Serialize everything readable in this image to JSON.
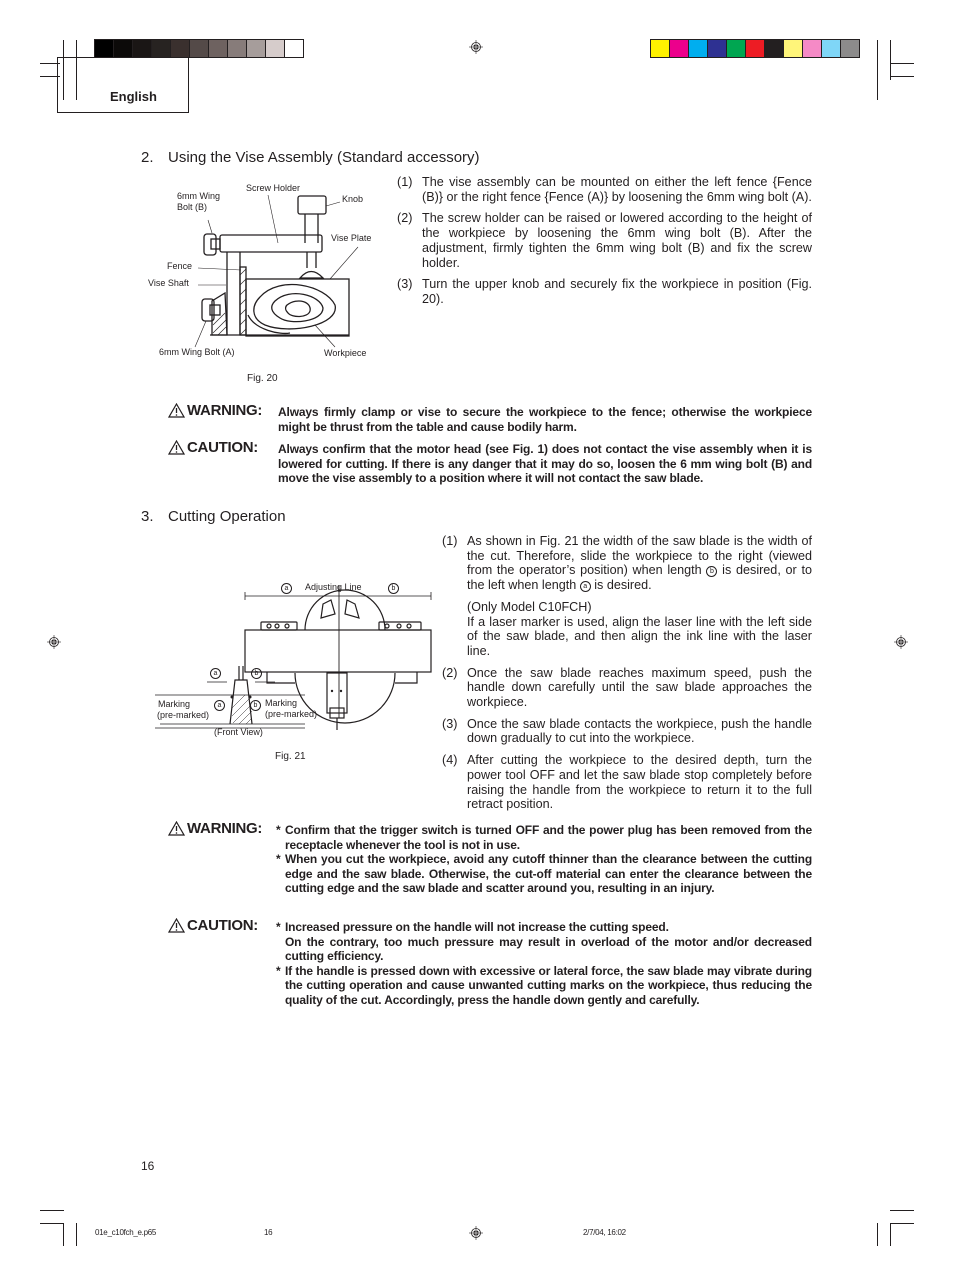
{
  "header": {
    "language": "English",
    "gray_swatches": [
      "#000000",
      "#0c0a09",
      "#1a1615",
      "#272321",
      "#3a302e",
      "#544a48",
      "#6e6260",
      "#877c7a",
      "#a69d9b",
      "#d6cccb",
      "#ffffff"
    ],
    "color_swatches": [
      "#fff200",
      "#ec008c",
      "#00aeef",
      "#2e3192",
      "#00a651",
      "#ed1c24",
      "#231f20",
      "#fff57a",
      "#f58ac6",
      "#7fd6f7",
      "#8c8b8b"
    ]
  },
  "section2": {
    "number": "2.",
    "title": "Using the Vise Assembly (Standard accessory)",
    "figure": {
      "caption": "Fig. 20",
      "labels": {
        "screw_holder": "Screw Holder",
        "wing_bolt_b_line1": "6mm Wing",
        "wing_bolt_b_line2": "Bolt (B)",
        "knob": "Knob",
        "vise_plate": "Vise Plate",
        "fence": "Fence",
        "vise_shaft": "Vise Shaft",
        "wing_bolt_a": "6mm Wing Bolt (A)",
        "workpiece": "Workpiece"
      }
    },
    "steps": [
      {
        "num": "(1)",
        "text": "The vise assembly can be mounted on either the left fence {Fence (B)} or the right fence {Fence (A)} by loosening the 6mm wing bolt (A)."
      },
      {
        "num": "(2)",
        "text": "The screw holder can be raised or lowered according to the height of the workpiece by loosening the 6mm wing bolt (B). After the adjustment, firmly tighten the 6mm wing bolt (B) and fix the screw holder."
      },
      {
        "num": "(3)",
        "text": "Turn the upper knob and securely fix the workpiece in position (Fig. 20)."
      }
    ],
    "warning": {
      "label": "WARNING:",
      "text": "Always firmly clamp or vise to secure the workpiece to the fence; otherwise the workpiece might be thrust from the table and  cause bodily harm."
    },
    "caution": {
      "label": "CAUTION:",
      "text": "Always confirm that the motor head (see Fig. 1) does not contact the vise assembly when it is lowered for cutting. If there is any danger that it may do so, loosen the 6 mm wing bolt (B) and move the vise assembly to a position where it will not contact the saw blade."
    }
  },
  "section3": {
    "number": "3.",
    "title": "Cutting Operation",
    "figure": {
      "caption": "Fig. 21",
      "labels": {
        "a": "a",
        "b": "b",
        "adjusting_line": "Adjusting Line",
        "marking_left_1": "Marking",
        "marking_left_2": "(pre-marked)",
        "marking_right_1": "Marking",
        "marking_right_2": "(pre-marked)",
        "front_view": "(Front View)"
      }
    },
    "steps": [
      {
        "num": "(1)",
        "text_before_b": "As shown in Fig. 21 the width of the saw blade is the width of the cut. Therefore, slide the workpiece to the right (viewed from the operator’s position) when length",
        "circ_b": "b",
        "text_mid": "is desired, or to the left when length",
        "circ_a": "a",
        "text_after": "is desired.",
        "model_note": "(Only Model C10FCH)",
        "laser_text": "If a laser marker is used, align the laser line with the left side of the saw blade, and then align the ink line with the laser line."
      },
      {
        "num": "(2)",
        "text": "Once the saw blade reaches maximum speed, push the handle down carefully until the saw blade approaches the workpiece."
      },
      {
        "num": "(3)",
        "text": "Once the saw blade contacts the workpiece, push the handle down gradually to cut into the workpiece."
      },
      {
        "num": "(4)",
        "text": "After cutting the workpiece to the desired depth, turn the power tool OFF and let the saw blade stop completely before raising the handle from the workpiece to return it to the full retract position."
      }
    ],
    "warning": {
      "label": "WARNING:",
      "bullets": [
        {
          "star": "*",
          "text": "Confirm that the trigger switch is turned OFF and the power plug has been removed from the receptacle whenever the tool is not in use."
        },
        {
          "star": "*",
          "text": "When you cut the workpiece, avoid any cutoff thinner than the clearance between the cutting edge and the saw blade. Otherwise, the cut-off material can enter the clearance between the cutting edge and the saw blade and scatter around you, resulting in an injury."
        }
      ]
    },
    "caution": {
      "label": "CAUTION:",
      "bullets": [
        {
          "star": "*",
          "text": "Increased pressure on the handle will not increase the cutting speed.",
          "text2": "On the contrary, too much pressure may result in overload of the motor and/or decreased cutting efficiency."
        },
        {
          "star": "*",
          "text": "If the handle is pressed down with excessive or lateral force, the saw blade may vibrate during the cutting operation and cause unwanted cutting marks on the workpiece, thus reducing the quality of the cut. Accordingly, press the handle down gently and carefully."
        }
      ]
    }
  },
  "footer": {
    "page_number": "16",
    "file_name": "01e_c10fch_e.p65",
    "file_page": "16",
    "timestamp": "2/7/04, 16:02"
  }
}
